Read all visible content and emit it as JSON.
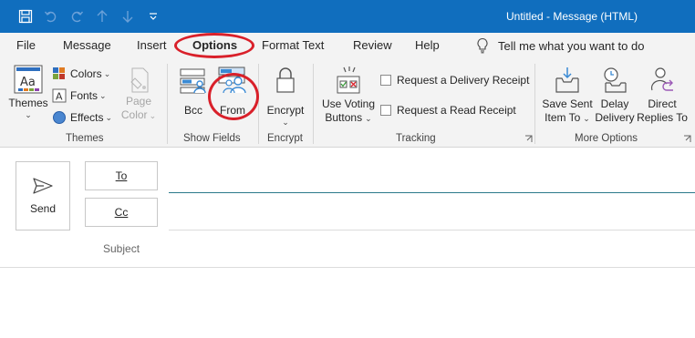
{
  "window": {
    "title": "Untitled  -  Message (HTML)"
  },
  "quick_access": {
    "icons": [
      "save-icon",
      "undo-icon",
      "redo-icon",
      "up-arrow-icon",
      "down-arrow-icon",
      "customize-icon"
    ]
  },
  "tabs": [
    {
      "label": "File"
    },
    {
      "label": "Message"
    },
    {
      "label": "Insert"
    },
    {
      "label": "Options",
      "active": true
    },
    {
      "label": "Format Text"
    },
    {
      "label": "Review"
    },
    {
      "label": "Help"
    }
  ],
  "tell_me": {
    "placeholder": "Tell me what you want to do"
  },
  "ribbon": {
    "themes_group": {
      "label": "Themes",
      "themes_button": "Themes",
      "colors": "Colors",
      "fonts": "Fonts",
      "effects": "Effects",
      "page_color_line1": "Page",
      "page_color_line2": "Color"
    },
    "show_fields_group": {
      "label": "Show Fields",
      "bcc": "Bcc",
      "from": "From"
    },
    "encrypt_group": {
      "label": "Encrypt",
      "encrypt_button": "Encrypt"
    },
    "tracking_group": {
      "label": "Tracking",
      "voting_line1": "Use Voting",
      "voting_line2": "Buttons",
      "delivery_receipt": "Request a Delivery Receipt",
      "read_receipt": "Request a Read Receipt"
    },
    "more_options_group": {
      "label": "More Options",
      "save_sent_line1": "Save Sent",
      "save_sent_line2": "Item To",
      "delay_line1": "Delay",
      "delay_line2": "Delivery",
      "direct_line1": "Direct",
      "direct_line2": "Replies To"
    }
  },
  "compose": {
    "send": "Send",
    "to": "To",
    "cc": "Cc",
    "subject": "Subject"
  },
  "colors": {
    "titlebar": "#106ebe",
    "highlight": "#d9202a",
    "accent_line": "#2b7a8a"
  }
}
